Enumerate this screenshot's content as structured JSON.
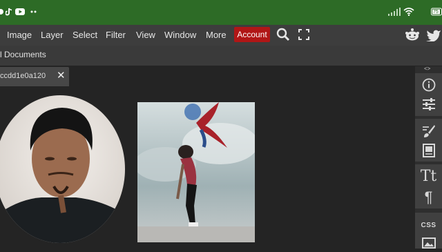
{
  "status_bar": {
    "icons": [
      "notification-app-icon",
      "tiktok-icon",
      "youtube-icon",
      "more-notifications-icon",
      "signal-icon",
      "wifi-icon",
      "battery-icon"
    ],
    "battery_label": "75"
  },
  "menu": {
    "items": [
      "Image",
      "Layer",
      "Select",
      "Filter",
      "View",
      "Window",
      "More"
    ],
    "account_label": "Account",
    "account_color": "#b01616"
  },
  "documents": {
    "label": "l Documents"
  },
  "tab": {
    "name": "ccdd1e0a120"
  },
  "right_panel": {
    "collapse_label": "<>",
    "css_label": "CSS",
    "icons": [
      "info-icon",
      "adjustments-icon",
      "brush-icon",
      "swatch-icon",
      "text-icon",
      "paragraph-icon",
      "css-icon",
      "image-icon"
    ]
  },
  "colors": {
    "status_bar": "#2d6b26",
    "menubar": "#3d3d3d",
    "workspace": "#242424"
  }
}
